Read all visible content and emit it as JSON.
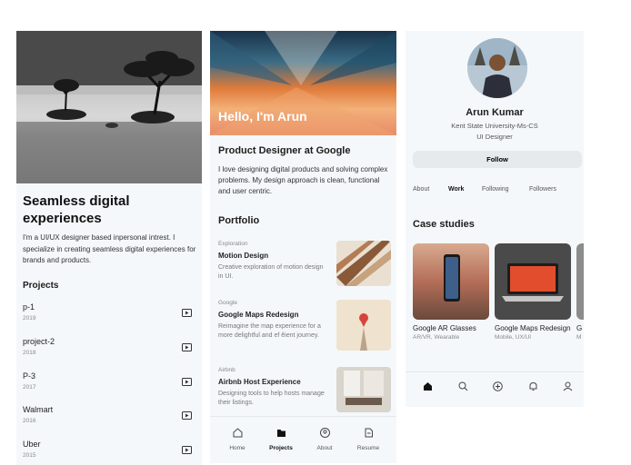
{
  "panel1": {
    "title": "Seamless digital experiences",
    "description": "I'm a UI/UX designer based inpersonal intrest. I specialize in creating seamless digital experiences for brands and products.",
    "projects_heading": "Projects",
    "projects": [
      {
        "name": "p-1",
        "year": "2019"
      },
      {
        "name": "project-2",
        "year": "2018"
      },
      {
        "name": "P-3",
        "year": "2017"
      },
      {
        "name": "Walmart",
        "year": "2016"
      },
      {
        "name": "Uber",
        "year": "2015"
      }
    ]
  },
  "panel2": {
    "hero_name": "Hello, I'm Arun",
    "role": "Product Designer at Google",
    "description": "I love designing digital products and solving complex problems. My design approach is clean, functional and user centric.",
    "portfolio_heading": "Portfolio",
    "cards": [
      {
        "category": "Exploration",
        "title": "Motion Design",
        "desc": "Creative exploration of motion design in UI."
      },
      {
        "category": "Google",
        "title": "Google Maps Redesign",
        "desc": "Reimagine the map experience for a more delightful and ef  ĕient journey."
      },
      {
        "category": "Airbnb",
        "title": "Airbnb Host Experience",
        "desc": "Designing tools to help hosts manage their listings."
      }
    ],
    "nav": [
      {
        "label": "Home",
        "icon": "home-icon"
      },
      {
        "label": "Projects",
        "icon": "folder-icon"
      },
      {
        "label": "About",
        "icon": "person-icon"
      },
      {
        "label": "Resume",
        "icon": "document-icon"
      }
    ]
  },
  "panel3": {
    "name": "Arun Kumar",
    "university": "Kent State University-Ms-CS",
    "role": "UI Designer",
    "follow_label": "Follow",
    "tabs": [
      "About",
      "Work",
      "Following",
      "Followers"
    ],
    "case_heading": "Case studies",
    "cases": [
      {
        "title": "Google AR Glasses",
        "sub": "AR/VR, Wearable"
      },
      {
        "title": "Google Maps Redesign",
        "sub": "Mobile, UX/UI"
      },
      {
        "title": "G",
        "sub": "M"
      }
    ],
    "nav_icons": [
      "home-icon",
      "search-icon",
      "add-icon",
      "bell-icon",
      "profile-icon"
    ]
  }
}
